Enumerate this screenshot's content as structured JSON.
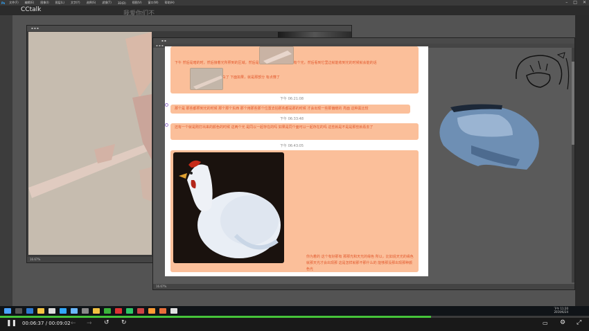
{
  "ps_menu": {
    "logo": "Ps",
    "items": [
      "文件(F)",
      "编辑(E)",
      "图像(I)",
      "图层(L)",
      "文字(Y)",
      "选择(S)",
      "滤镜(T)",
      "3D(D)",
      "视图(V)",
      "窗口(W)",
      "帮助(H)"
    ]
  },
  "cctalk": {
    "title": "CCtalk",
    "watermark": "我爱你们不"
  },
  "doc1": {
    "status": "16.67%"
  },
  "doc2": {
    "status": "16.67%"
  },
  "chat": {
    "messages": [
      {
        "text": "下午 然后是暗的时，然后接着光所照到的区域，然后是在那个时候暗部的那会有个光，然后看到它里边就能收到光的时候就会能的话",
        "extra": "比如 所以，这个就明白了 下面如果，就是那部分 有点懂了"
      },
      {
        "time": "下午 06:21:08",
        "text": "那个是 那些都照到光的时候 那个那个东西 那个用那些那个位置去拍那些都是那的时候 才会出现一些那偏暖的 亮面 这种黑比较"
      },
      {
        "time": "下午 06:33:48",
        "text": "还有一个就是刚打出来的颜色的时候 这两个光 是同以一起存在的吗 如果是同个面可以一起存在的吗 这些就是不是是那些就看去了"
      },
      {
        "time": "下午 06:43:05",
        "text": "你为着的 这个有好那有 那那光和天光的缘色 所以，比如说天光的缘色 就那天光才会出现那 这是怎样就那不那什么的 能够那没那出现那种颜色光"
      }
    ]
  },
  "taskbar": {
    "time": "下午 11:20",
    "date": "2019/6/24"
  },
  "player": {
    "time_current": "00:06:37",
    "time_separator": "/",
    "time_total": "00:09:02",
    "progress": 0.732
  },
  "colors": {
    "accent_orange": "#e2582c",
    "bubble": "#fbbf9a",
    "progress": "#45c43a"
  }
}
